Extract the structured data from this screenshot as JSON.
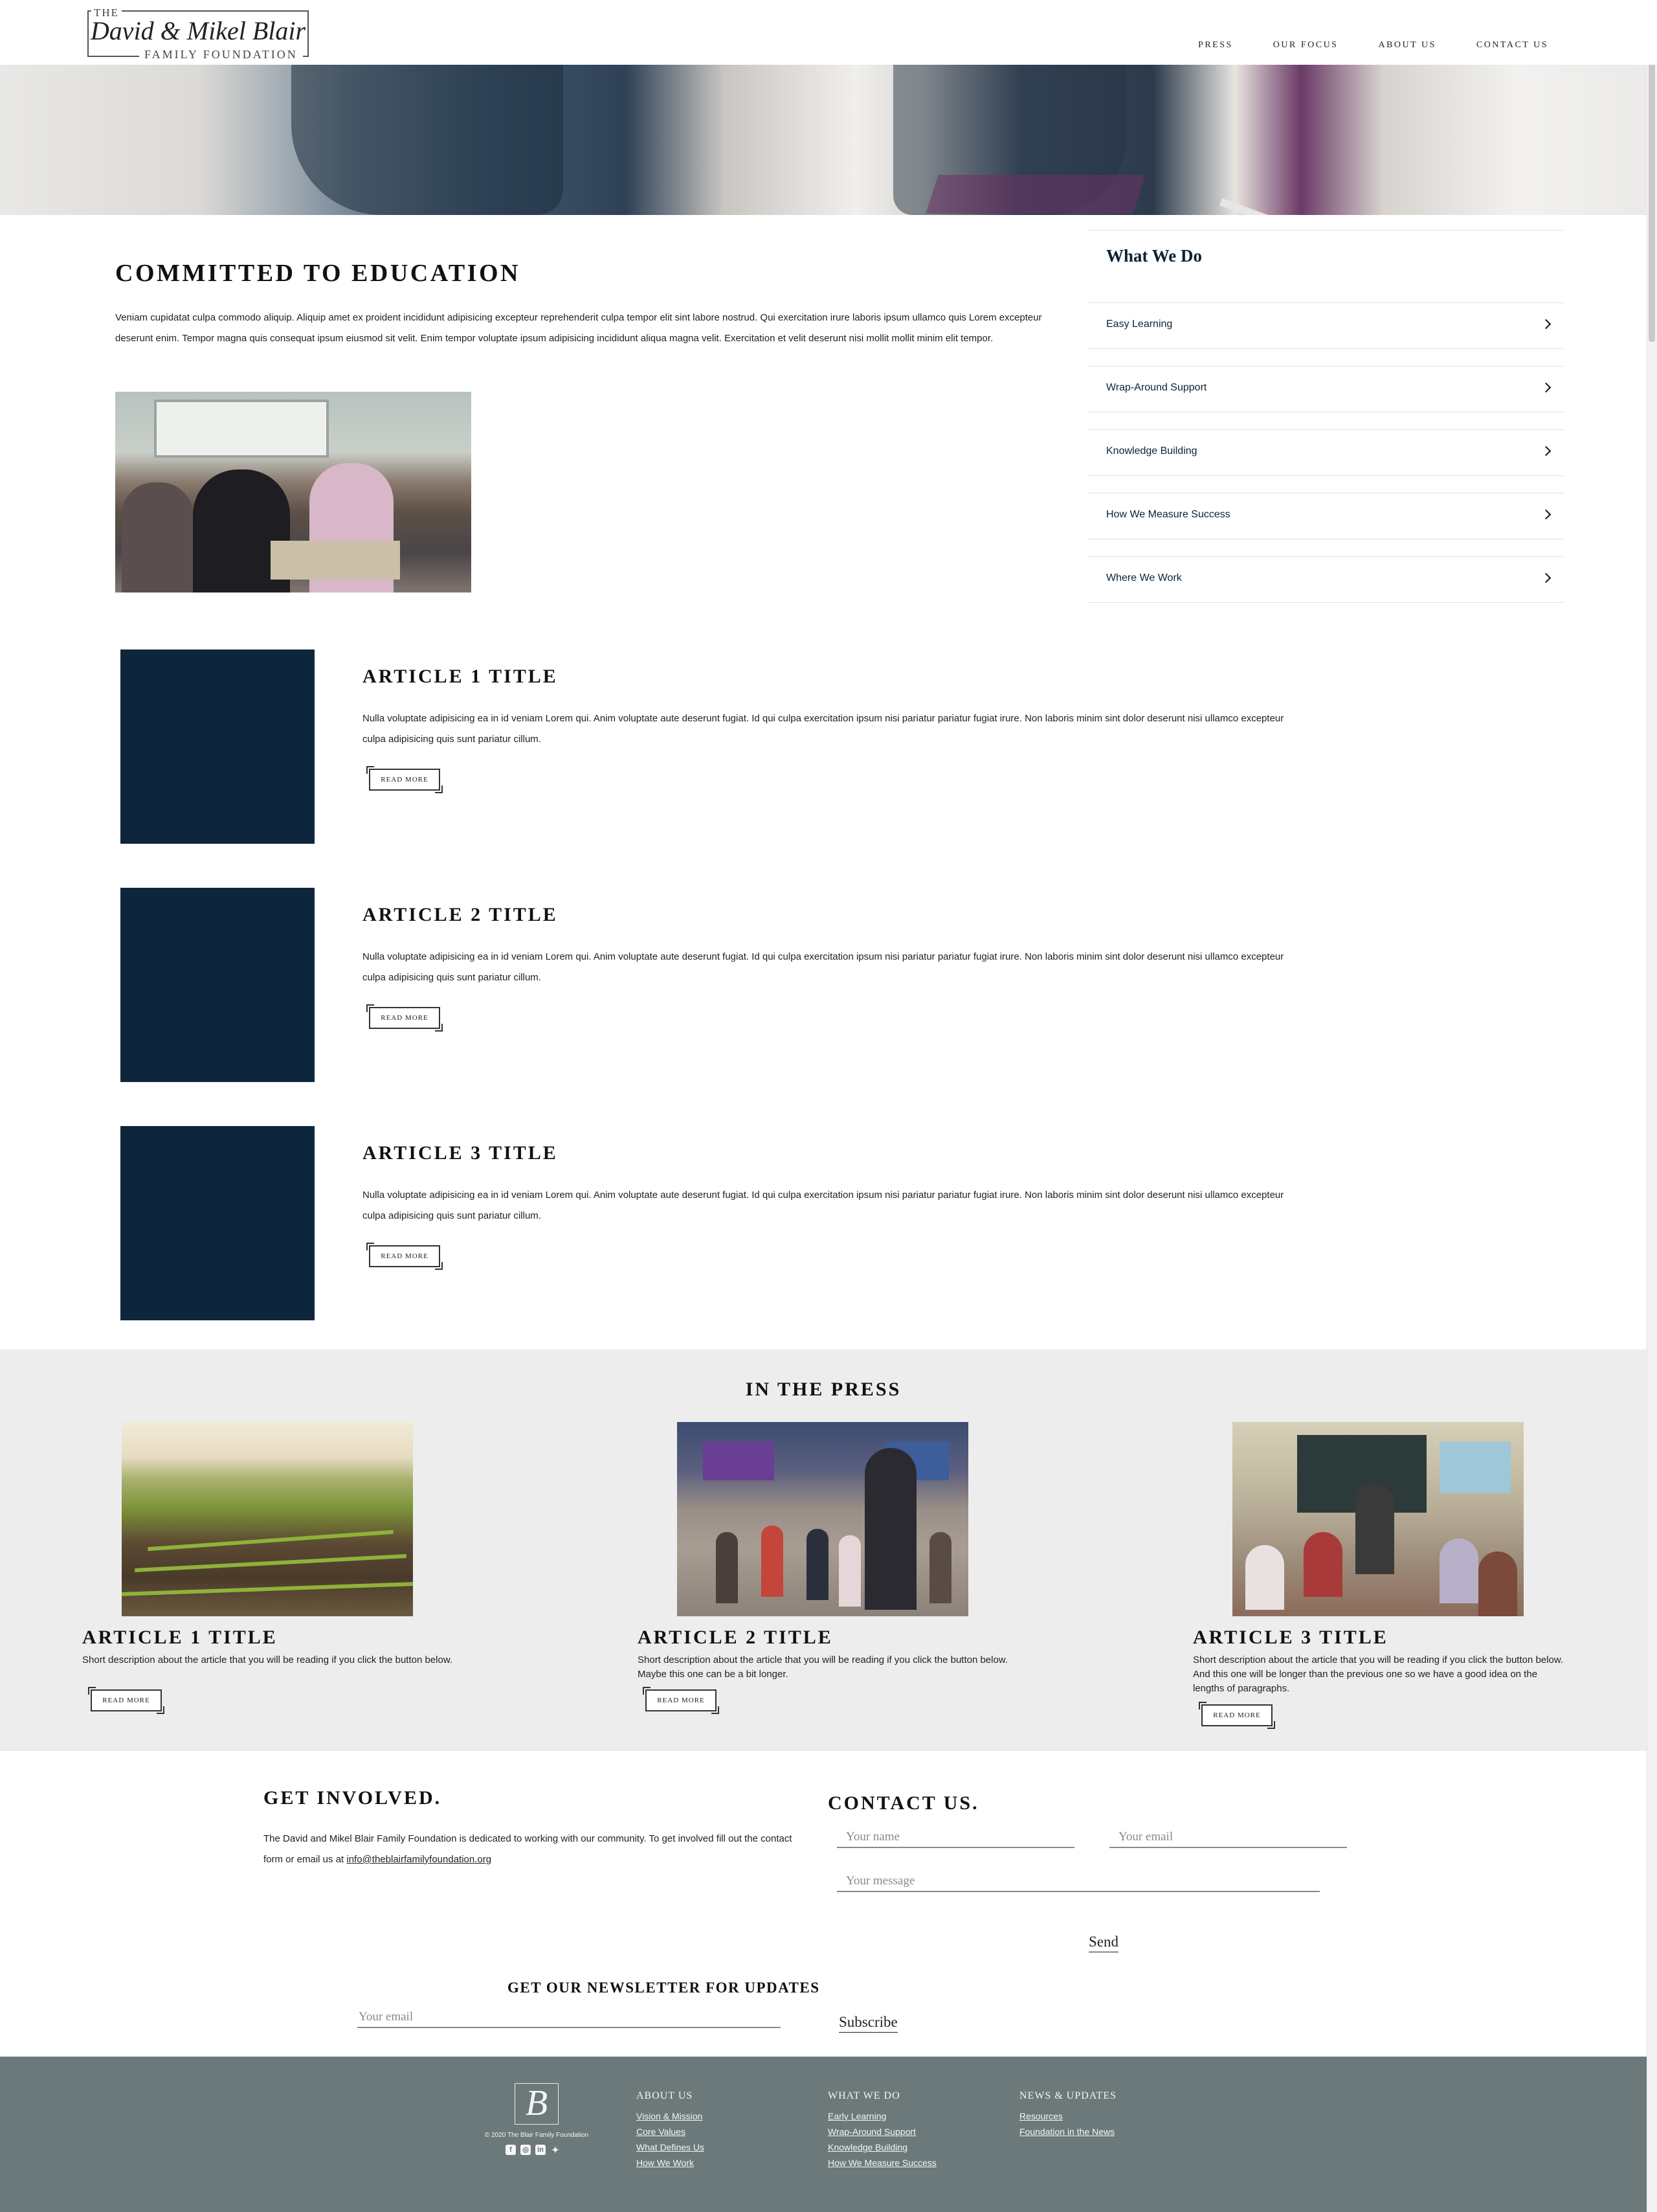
{
  "header": {
    "logo": {
      "the": "THE",
      "name": "David & Mikel Blair",
      "subtitle": "FAMILY FOUNDATION"
    },
    "nav": [
      "PRESS",
      "OUR FOCUS",
      "ABOUT US",
      "CONTACT US"
    ]
  },
  "committed": {
    "title": "COMMITTED TO EDUCATION",
    "text": "Veniam cupidatat culpa commodo aliquip. Aliquip amet ex proident incididunt adipisicing excepteur reprehenderit culpa tempor elit sint labore nostrud. Qui exercitation irure laboris ipsum ullamco quis Lorem excepteur deserunt enim. Tempor magna quis consequat ipsum eiusmod sit velit. Enim tempor voluptate ipsum adipisicing incididunt aliqua magna velit. Exercitation et velit deserunt nisi mollit mollit minim elit tempor."
  },
  "what_we_do": {
    "title": "What We Do",
    "items": [
      "Easy Learning",
      "Wrap-Around Support",
      "Knowledge Building",
      "How We Measure Success",
      "Where We Work"
    ]
  },
  "articles": [
    {
      "title": "ARTICLE 1 TITLE",
      "text": "Nulla voluptate adipisicing ea in id veniam Lorem qui. Anim voluptate aute deserunt fugiat. Id qui culpa exercitation ipsum nisi pariatur pariatur fugiat irure. Non laboris minim sint dolor deserunt nisi ullamco excepteur culpa adipisicing quis sunt pariatur cillum.",
      "button": "READ MORE"
    },
    {
      "title": "ARTICLE 2 TITLE",
      "text": "Nulla voluptate adipisicing ea in id veniam Lorem qui. Anim voluptate aute deserunt fugiat. Id qui culpa exercitation ipsum nisi pariatur pariatur fugiat irure. Non laboris minim sint dolor deserunt nisi ullamco excepteur culpa adipisicing quis sunt pariatur cillum.",
      "button": "READ MORE"
    },
    {
      "title": "ARTICLE 3 TITLE",
      "text": "Nulla voluptate adipisicing ea in id veniam Lorem qui. Anim voluptate aute deserunt fugiat. Id qui culpa exercitation ipsum nisi pariatur pariatur fugiat irure. Non laboris minim sint dolor deserunt nisi ullamco excepteur culpa adipisicing quis sunt pariatur cillum.",
      "button": "READ MORE"
    }
  ],
  "press": {
    "title": "IN THE PRESS",
    "items": [
      {
        "title": "ARTICLE 1 TITLE",
        "desc": "Short description about the article that you will be reading if you click the button below.",
        "button": "READ MORE"
      },
      {
        "title": "ARTICLE 2 TITLE",
        "desc": "Short description about the article that you will be reading if you click the button below. Maybe this one can be a bit longer.",
        "button": "READ MORE"
      },
      {
        "title": "ARTICLE 3 TITLE",
        "desc": "Short description about the article that you will be reading if you click the button below. And this one will be longer than the previous one so we have a good idea on the lengths of paragraphs.",
        "button": "READ MORE"
      }
    ]
  },
  "get_involved": {
    "title": "GET INVOLVED.",
    "text": "The David and Mikel Blair Family Foundation is dedicated to working with our community. To get involved fill out the contact form or email us at ",
    "email": "info@theblairfamilyfoundation.org"
  },
  "contact": {
    "title": "CONTACT US.",
    "name_placeholder": "Your name",
    "email_placeholder": "Your email",
    "message_placeholder": "Your message",
    "send": "Send"
  },
  "newsletter": {
    "title": "GET OUR NEWSLETTER FOR UPDATES",
    "email_placeholder": "Your email",
    "subscribe": "Subscribe"
  },
  "footer": {
    "monogram": "B",
    "copyright": "© 2020 The Blair Family Foundation",
    "social": [
      "facebook-icon",
      "instagram-icon",
      "linkedin-icon",
      "twitter-icon"
    ],
    "columns": [
      {
        "head": "ABOUT US",
        "links": [
          "Vision & Mission",
          "Core Values",
          "What Defines Us",
          "How We Work"
        ]
      },
      {
        "head": "WHAT WE DO",
        "links": [
          "Early Learning",
          "Wrap-Around Support",
          "Knowledge Building",
          "How We Measure Success"
        ]
      },
      {
        "head": "NEWS & UPDATES",
        "links": [
          "Resources",
          "Foundation in the News"
        ]
      }
    ]
  },
  "colors": {
    "navy": "#0e263b",
    "press_bg": "#ededed",
    "footer_bg": "#6b797a"
  }
}
